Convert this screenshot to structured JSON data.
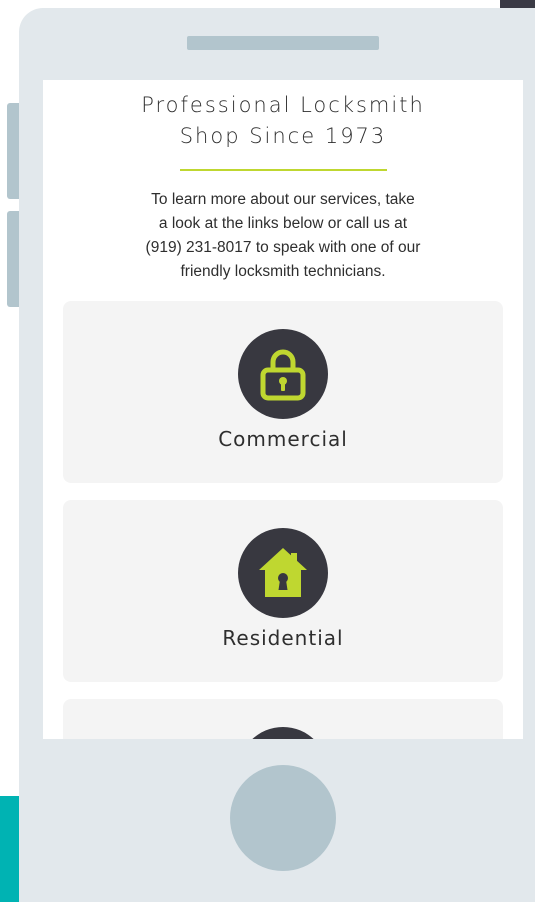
{
  "colors": {
    "accent": "#bfd730",
    "icon_background": "#383840",
    "card_background": "#f4f4f4",
    "device_frame": "#e2e8ec",
    "device_detail": "#b2c5cd",
    "teal": "#00b3b3"
  },
  "header": {
    "title_line_1": "Professional Locksmith",
    "title_line_2": "Shop Since 1973"
  },
  "intro": {
    "line_1": "To learn more about our services, take",
    "line_2": "a look at the links below or call us at",
    "line_3": "(919) 231-8017 to speak with one of our",
    "line_4": "friendly locksmith technicians."
  },
  "services": [
    {
      "label": "Commercial",
      "icon": "padlock-icon"
    },
    {
      "label": "Residential",
      "icon": "house-keyhole-icon"
    },
    {
      "label": "",
      "icon": "service-icon"
    }
  ]
}
